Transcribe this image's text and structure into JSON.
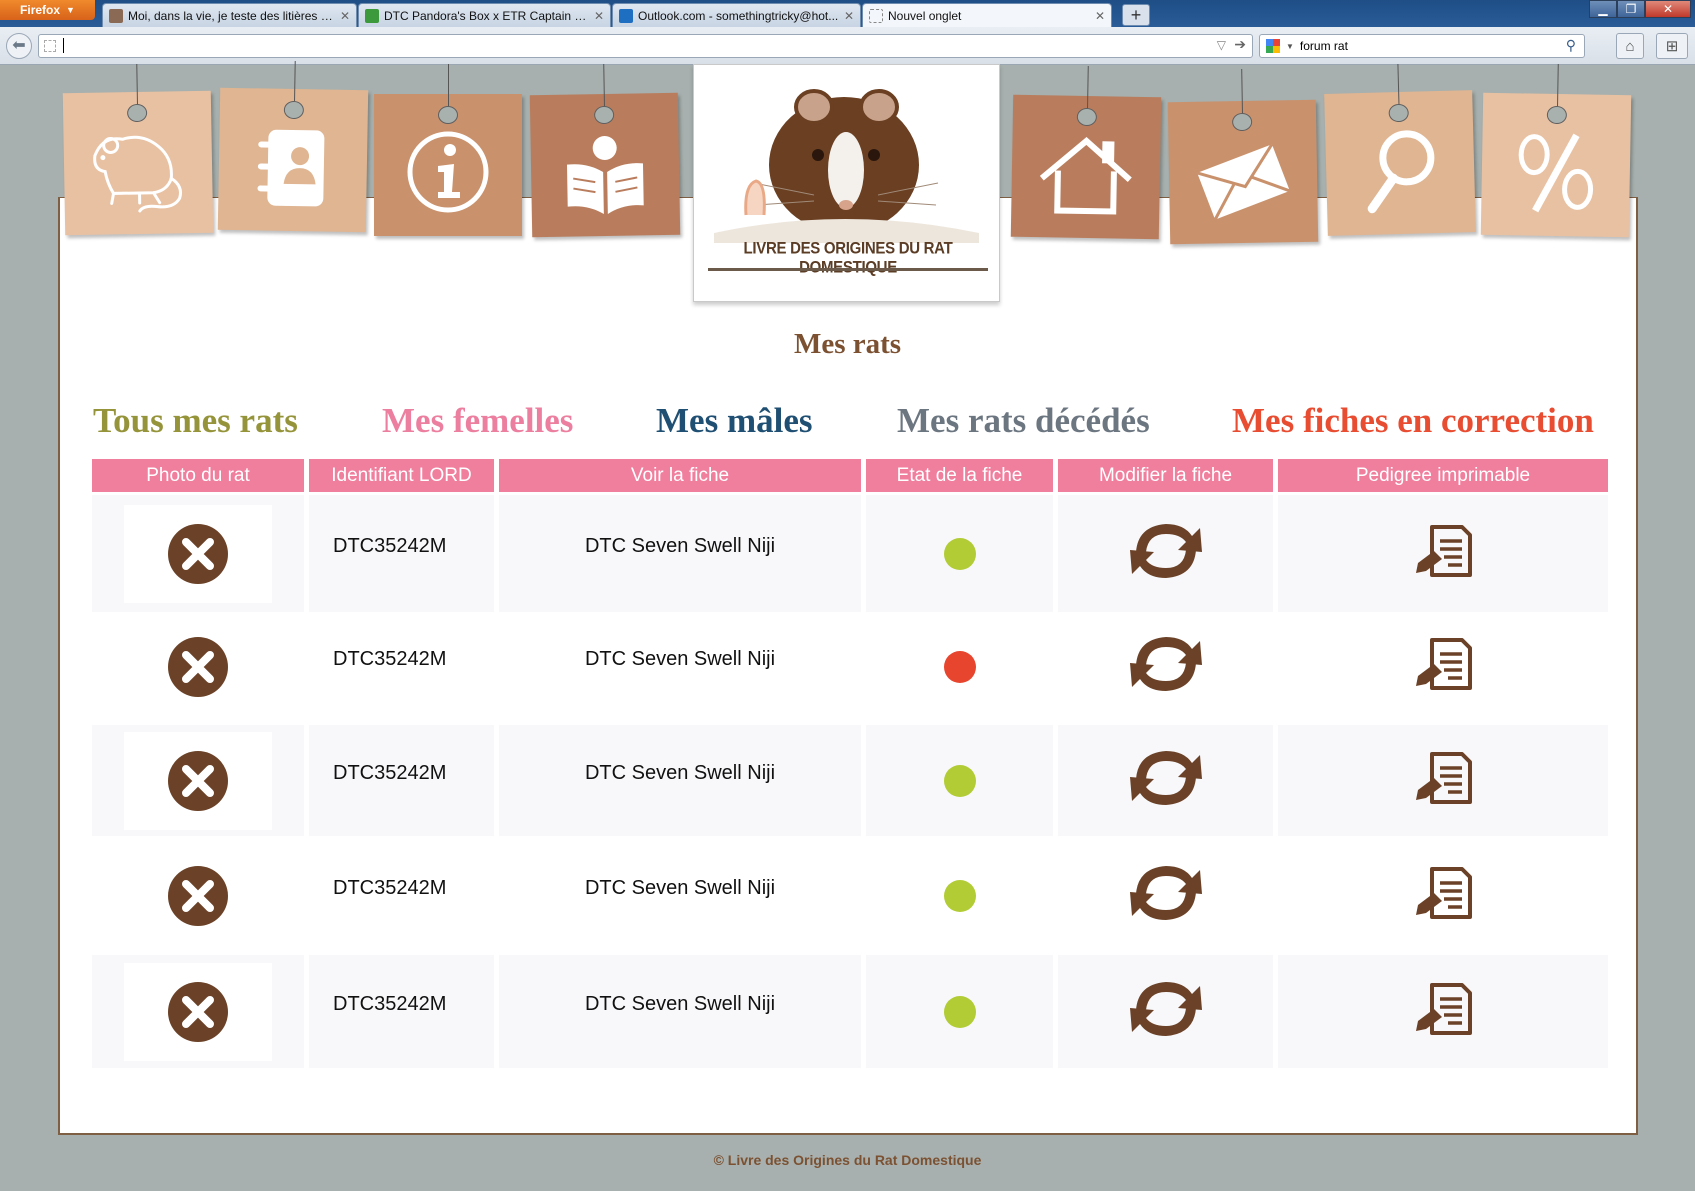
{
  "browser": {
    "app_button": "Firefox",
    "tabs": [
      {
        "label": "Moi, dans la vie, je teste des litières >..."
      },
      {
        "label": "DTC Pandora's Box x ETR Captain Ob..."
      },
      {
        "label": "Outlook.com - somethingtricky@hot..."
      },
      {
        "label": "Nouvel onglet"
      }
    ],
    "new_tab": "+",
    "url_value": "",
    "search_value": "forum rat",
    "colors": {
      "tabbar": "#2a5c98",
      "firefox_button": "#e8762a"
    }
  },
  "header": {
    "logo_text": "LIVRE DES ORIGINES DU RAT DOMESTIQUE",
    "nav_icons": [
      "rat-icon",
      "contacts-icon",
      "info-icon",
      "reading-icon",
      "home-icon",
      "mail-icon",
      "search-icon",
      "percent-icon"
    ]
  },
  "page": {
    "title": "Mes rats",
    "filters": [
      {
        "label": "Tous mes rats",
        "color": "#95943a"
      },
      {
        "label": "Mes femelles",
        "color": "#ec7fa0"
      },
      {
        "label": "Mes mâles",
        "color": "#1f4f72"
      },
      {
        "label": "Mes rats décédés",
        "color": "#6c7681"
      },
      {
        "label": "Mes fiches en correction",
        "color": "#e84d32"
      }
    ]
  },
  "table": {
    "headers": [
      "Photo du rat",
      "Identifiant LORD",
      "Voir la fiche",
      "Etat de la fiche",
      "Modifier la fiche",
      "Pedigree imprimable"
    ],
    "rows": [
      {
        "id": "DTC35242M",
        "name": "DTC Seven Swell Niji",
        "status": "ok"
      },
      {
        "id": "DTC35242M",
        "name": "DTC Seven Swell Niji",
        "status": "error"
      },
      {
        "id": "DTC35242M",
        "name": "DTC Seven Swell Niji",
        "status": "ok"
      },
      {
        "id": "DTC35242M",
        "name": "DTC Seven Swell Niji",
        "status": "ok"
      },
      {
        "id": "DTC35242M",
        "name": "DTC Seven Swell Niji",
        "status": "ok"
      }
    ],
    "status_colors": {
      "ok": "#b2cc36",
      "error": "#e8452f"
    },
    "icon_color": "#6b4228"
  },
  "footer": {
    "text": "© Livre des Origines du Rat Domestique"
  }
}
